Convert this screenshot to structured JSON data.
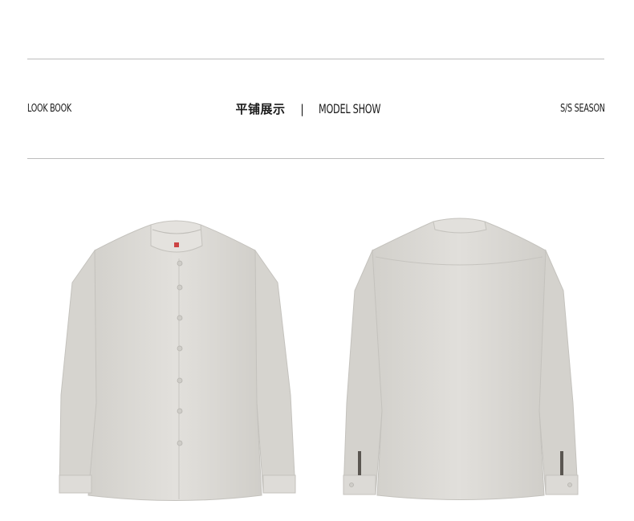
{
  "header": {
    "left_label": "LOOK BOOK",
    "center_title_cn": "平铺展示",
    "separator": "|",
    "center_title_en": "MODEL SHOW",
    "right_label": "S/S SEASON"
  },
  "products": [
    {
      "view": "front",
      "icon": "shirt-front"
    },
    {
      "view": "back",
      "icon": "shirt-back"
    }
  ],
  "colors": {
    "shirt_fabric": "#dcdad6",
    "rule_line": "#bdbdbd"
  }
}
